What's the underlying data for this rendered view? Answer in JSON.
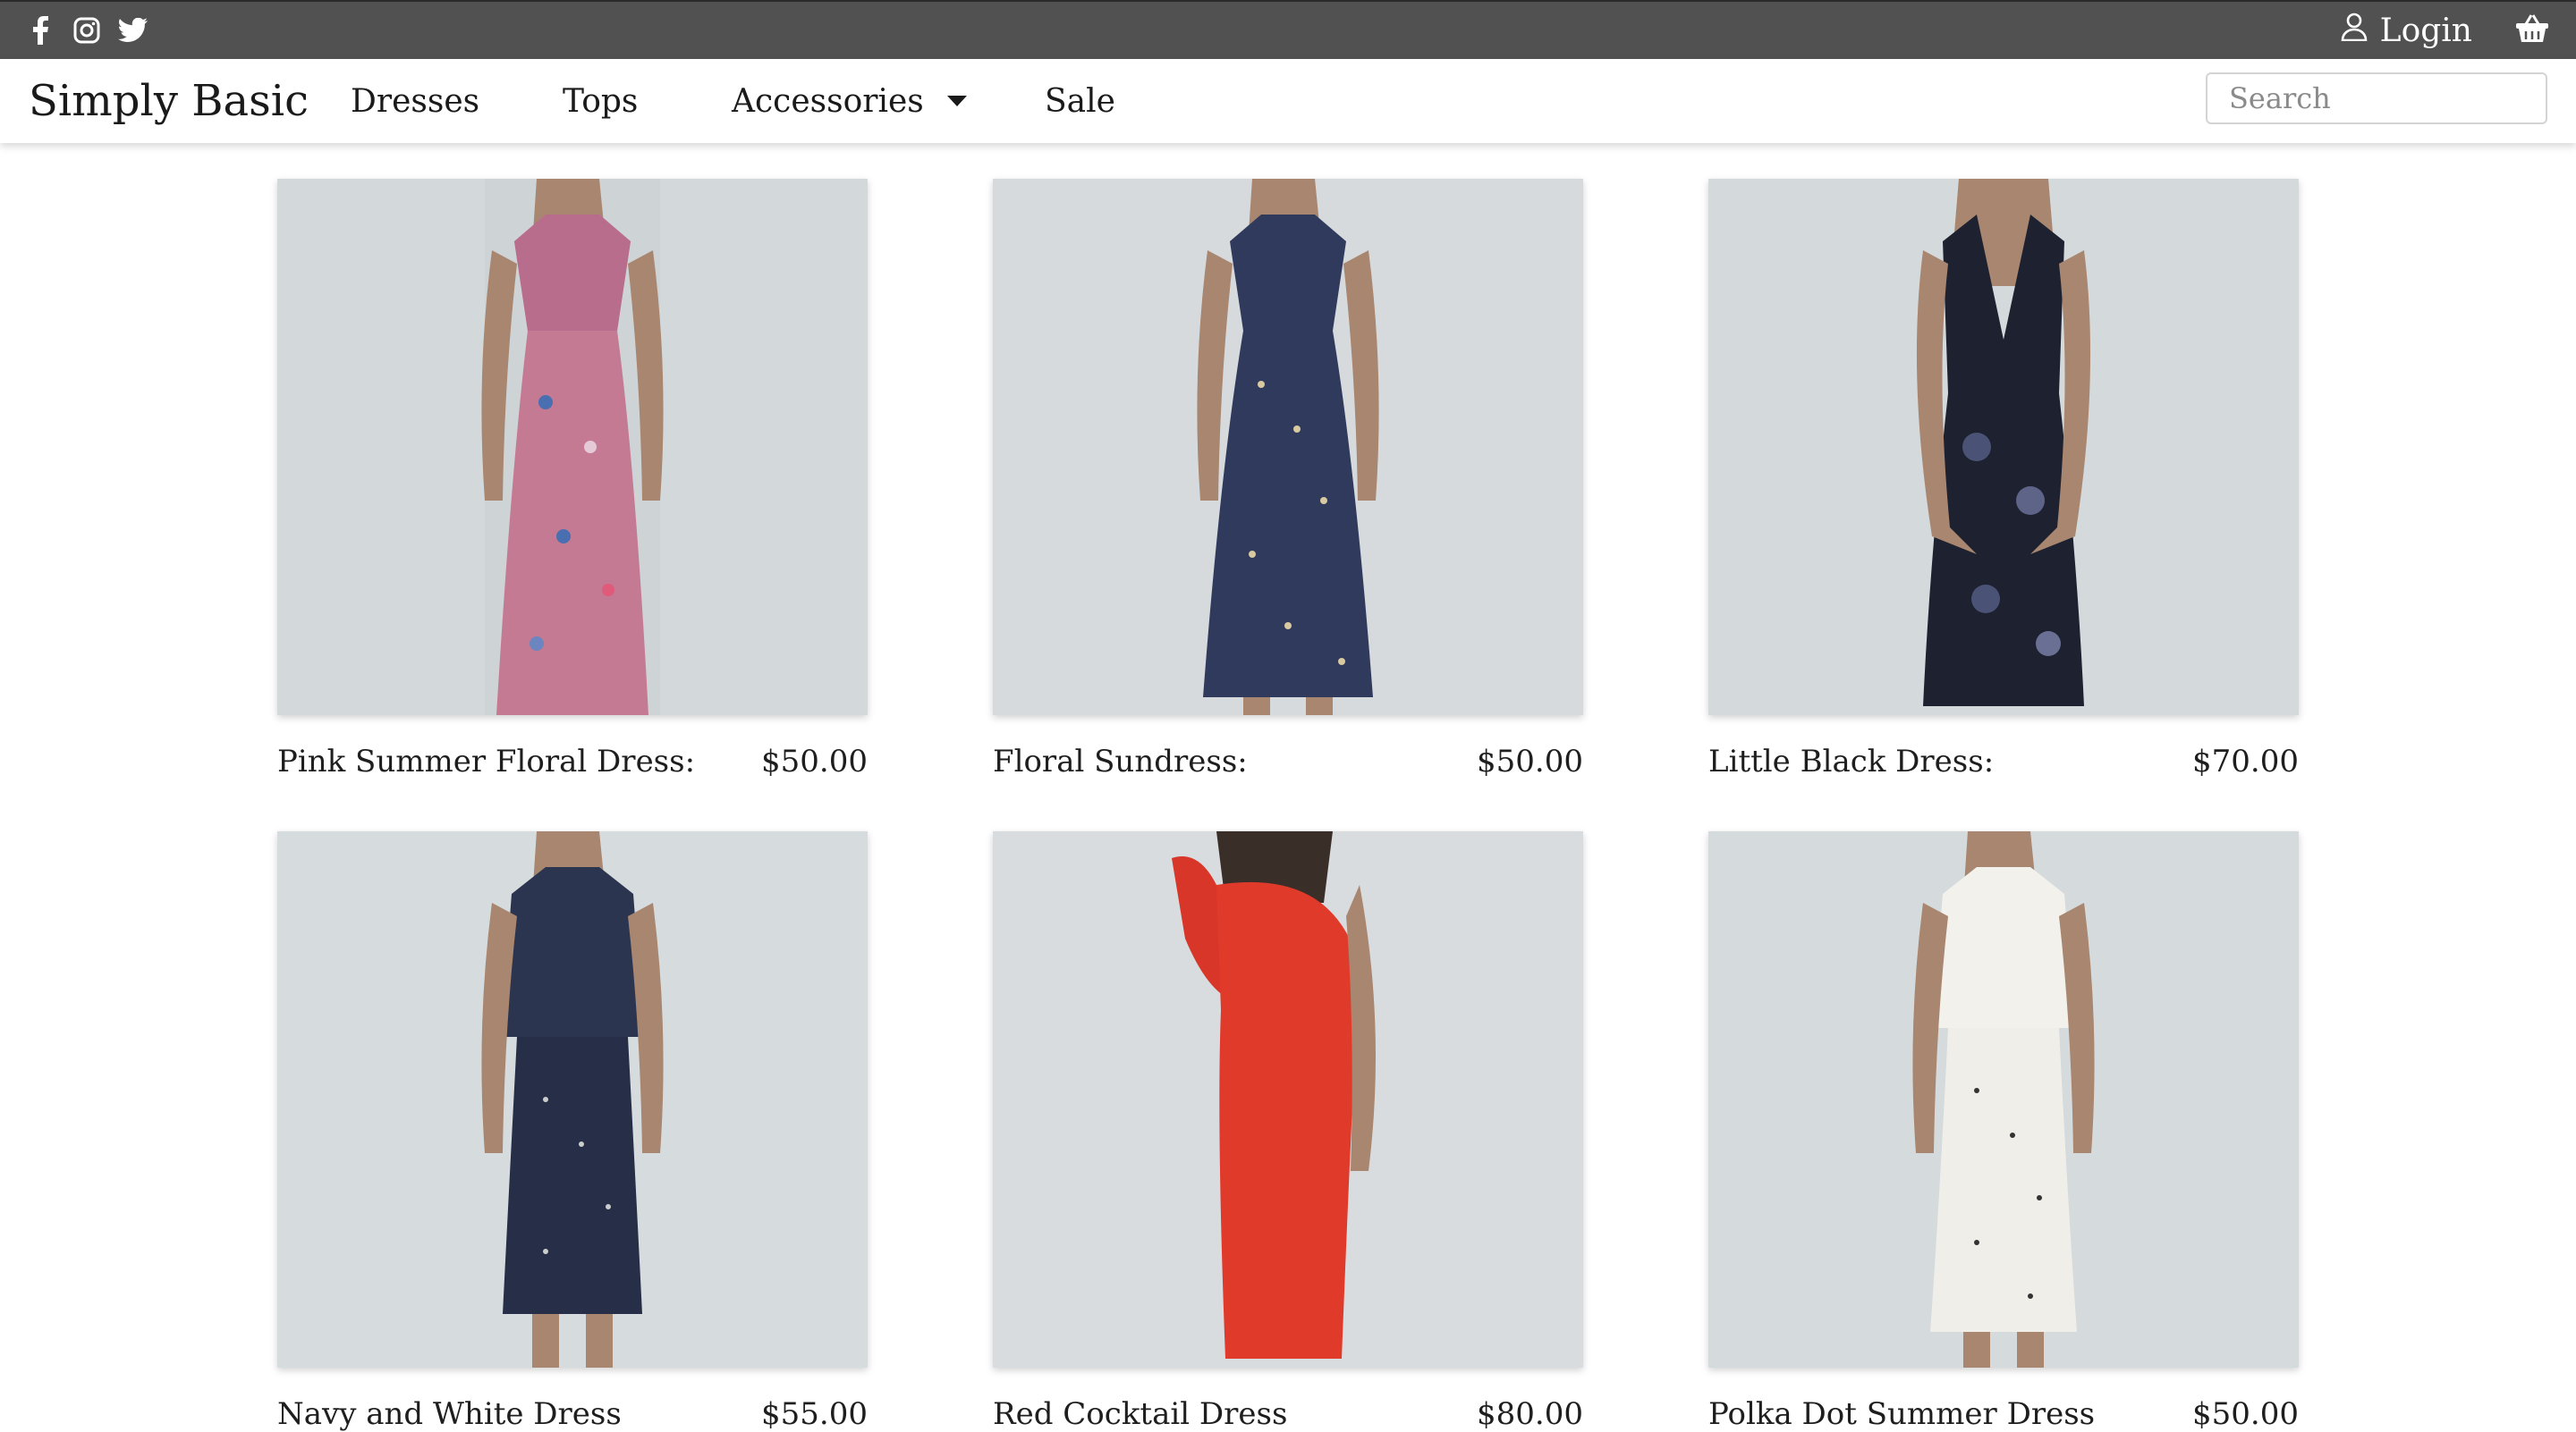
{
  "header": {
    "social_icons": [
      "facebook-icon",
      "instagram-icon",
      "twitter-icon"
    ],
    "login_label": "Login",
    "cart_icon": "basket-icon",
    "bar_color": "#515151"
  },
  "nav": {
    "brand": "Simply Basic",
    "items": [
      "Dresses",
      "Tops",
      "Accessories",
      "Sale"
    ],
    "search_placeholder": "Search"
  },
  "products": [
    {
      "name": "Pink Summer Floral Dress:",
      "price": "$50.00",
      "dress": "pink floral sundress"
    },
    {
      "name": "Floral Sundress:",
      "price": "$50.00",
      "dress": "navy floral sundress"
    },
    {
      "name": "Little Black Dress:",
      "price": "$70.00",
      "dress": "black sequin slip dress"
    },
    {
      "name": "Navy and White Dress",
      "price": "$55.00",
      "dress": "navy polka dot dress"
    },
    {
      "name": "Red Cocktail Dress",
      "price": "$80.00",
      "dress": "red one-shoulder ruffle dress"
    },
    {
      "name": "Polka Dot Summer Dress",
      "price": "$50.00",
      "dress": "white polka dot dress"
    }
  ]
}
